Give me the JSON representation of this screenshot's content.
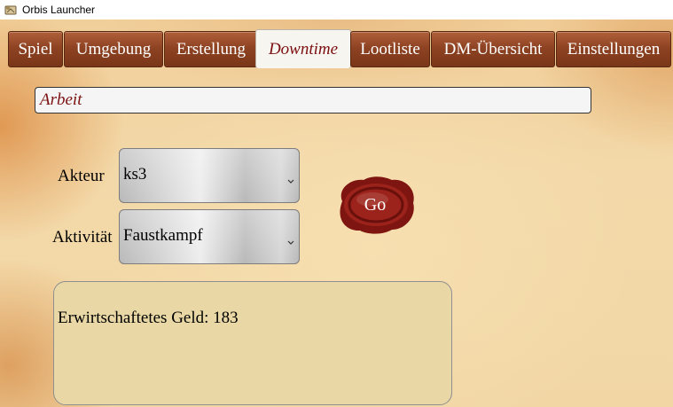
{
  "window": {
    "title": "Orbis Launcher",
    "icon": "scroll-icon"
  },
  "tabs": [
    {
      "label": "Spiel",
      "active": false
    },
    {
      "label": "Umgebung",
      "active": false
    },
    {
      "label": "Erstellung",
      "active": false
    },
    {
      "label": "Downtime",
      "active": true
    },
    {
      "label": "Lootliste",
      "active": false
    },
    {
      "label": "DM-Übersicht",
      "active": false
    },
    {
      "label": "Einstellungen",
      "active": false
    }
  ],
  "downtime": {
    "section_value": "Arbeit",
    "akteur": {
      "label": "Akteur",
      "value": "ks3"
    },
    "aktivitaet": {
      "label": "Aktivität",
      "value": "Faustkampf"
    },
    "go_label": "Go",
    "result": "Erwirtschaftetes Geld: 183"
  },
  "colors": {
    "tab_wood": "#8e4323",
    "active_tab_text": "#7b1010",
    "seal_red": "#8b1a14",
    "result_bg": "#e9d8a5"
  }
}
